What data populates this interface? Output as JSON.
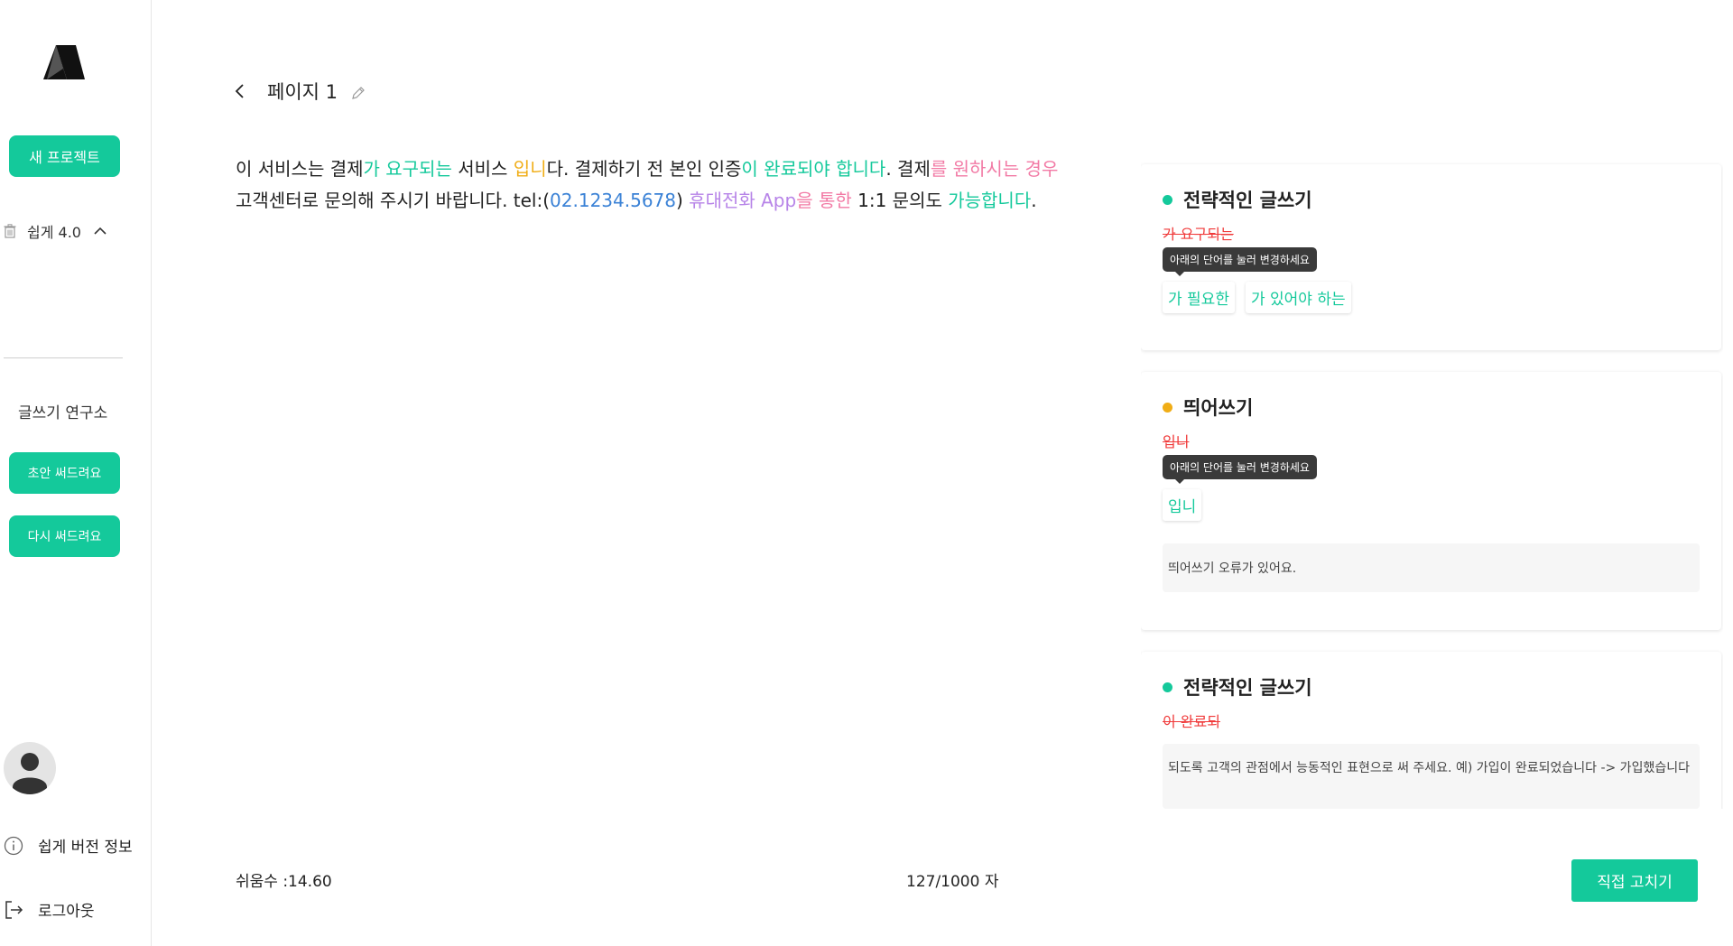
{
  "sidebar": {
    "new_project_label": "새 프로젝트",
    "project_name": "쉽게 4.0",
    "lab_title": "글쓰기 연구소",
    "draft_label": "초안 써드려요",
    "rewrite_label": "다시 써드려요",
    "version_info_label": "쉽게 버전 정보",
    "logout_label": "로그아웃"
  },
  "header": {
    "page_title": "페이지 1"
  },
  "editor": {
    "segments": [
      {
        "text": "이 서비스는 결제",
        "color": "default"
      },
      {
        "text": "가 요구되는",
        "color": "green"
      },
      {
        "text": " 서비스 ",
        "color": "default"
      },
      {
        "text": "입니",
        "color": "orange"
      },
      {
        "text": "다. 결제하기 전 본인 인증",
        "color": "default"
      },
      {
        "text": "이 완료되야 합니다",
        "color": "green"
      },
      {
        "text": ". 결제",
        "color": "default"
      },
      {
        "text": "를 원하시는 경우",
        "color": "pink"
      },
      {
        "text": " 고객센터로 문의해 주시기 바랍니다. tel:(",
        "color": "default"
      },
      {
        "text": "02.1234.5678",
        "color": "blue"
      },
      {
        "text": ") ",
        "color": "default"
      },
      {
        "text": "휴대전화 App",
        "color": "purple"
      },
      {
        "text": "을 통한",
        "color": "pink"
      },
      {
        "text": " 1:1 문의도 ",
        "color": "default"
      },
      {
        "text": "가능합니다",
        "color": "green"
      },
      {
        "text": ".",
        "color": "default"
      }
    ]
  },
  "footer": {
    "score_text": "쉬움수 :14.60",
    "count_text": "127/1000 자",
    "fix_button_label": "직접 고치기"
  },
  "suggestions": {
    "card1": {
      "title": "전략적인 글쓰기",
      "original": "가 요구되는",
      "tooltip": "아래의 단어를 눌러 변경하세요",
      "options": [
        "가 필요한",
        "가 있어야 하는"
      ]
    },
    "card2": {
      "title": "띄어쓰기",
      "original": "입니",
      "tooltip": "아래의 단어를 눌러 변경하세요",
      "options": [
        "입니"
      ],
      "note": "띄어쓰기 오류가 있어요."
    },
    "card3": {
      "title": "전략적인 글쓰기",
      "original": "이 완료되",
      "note": "되도록 고객의 관점에서 능동적인 표현으로 써 주세요. 예) 가입이 완료되었습니다 -> 가입했습니다"
    }
  },
  "colors": {
    "accent": "#14c99b",
    "orange": "#f0ad16",
    "pink": "#f27aa5",
    "blue": "#3b82d6",
    "purple": "#b784e8",
    "strike_red": "#f03a3a"
  }
}
